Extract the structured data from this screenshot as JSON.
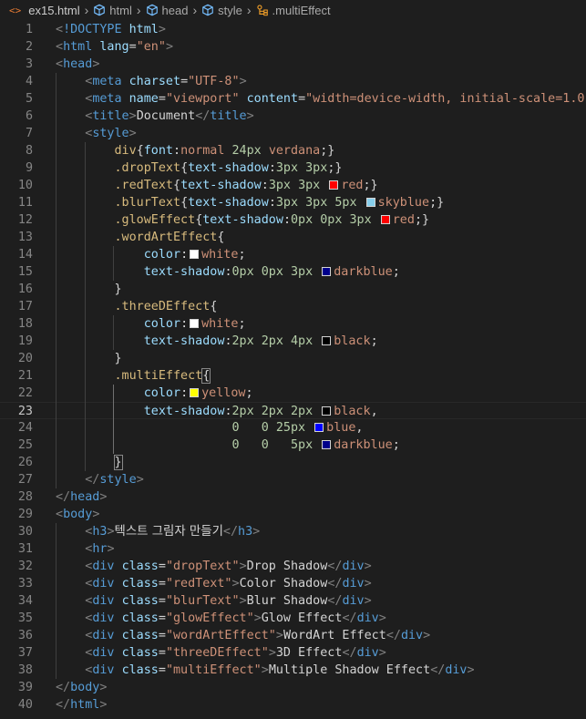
{
  "breadcrumb": {
    "file_icon": "<>",
    "file": "ex15.html",
    "items": [
      "html",
      "head",
      "style"
    ],
    "symbol": ".multiEffect"
  },
  "editor": {
    "line_numbers": [
      "1",
      "2",
      "3",
      "4",
      "5",
      "6",
      "7",
      "8",
      "9",
      "10",
      "11",
      "12",
      "13",
      "14",
      "15",
      "16",
      "17",
      "18",
      "19",
      "20",
      "21",
      "22",
      "23",
      "24",
      "25",
      "26",
      "27",
      "28",
      "29",
      "30",
      "31",
      "32",
      "33",
      "34",
      "35",
      "36",
      "37",
      "38",
      "39",
      "40"
    ],
    "active_line": 23,
    "lines": [
      [
        [
          "brk",
          "<"
        ],
        [
          "tag",
          "!DOCTYPE"
        ],
        [
          "txt",
          " "
        ],
        [
          "attr",
          "html"
        ],
        [
          "brk",
          ">"
        ]
      ],
      [
        [
          "brk",
          "<"
        ],
        [
          "tag",
          "html"
        ],
        [
          "txt",
          " "
        ],
        [
          "attr",
          "lang"
        ],
        [
          "txt",
          "="
        ],
        [
          "str",
          "\"en\""
        ],
        [
          "brk",
          ">"
        ]
      ],
      [
        [
          "brk",
          "<"
        ],
        [
          "tag",
          "head"
        ],
        [
          "brk",
          ">"
        ]
      ],
      [
        [
          "txt",
          "    "
        ],
        [
          "brk",
          "<"
        ],
        [
          "tag",
          "meta"
        ],
        [
          "txt",
          " "
        ],
        [
          "attr",
          "charset"
        ],
        [
          "txt",
          "="
        ],
        [
          "str",
          "\"UTF-8\""
        ],
        [
          "brk",
          ">"
        ]
      ],
      [
        [
          "txt",
          "    "
        ],
        [
          "brk",
          "<"
        ],
        [
          "tag",
          "meta"
        ],
        [
          "txt",
          " "
        ],
        [
          "attr",
          "name"
        ],
        [
          "txt",
          "="
        ],
        [
          "str",
          "\"viewport\""
        ],
        [
          "txt",
          " "
        ],
        [
          "attr",
          "content"
        ],
        [
          "txt",
          "="
        ],
        [
          "str",
          "\"width=device-width, initial-scale=1.0\""
        ],
        [
          "brk",
          ">"
        ]
      ],
      [
        [
          "txt",
          "    "
        ],
        [
          "brk",
          "<"
        ],
        [
          "tag",
          "title"
        ],
        [
          "brk",
          ">"
        ],
        [
          "txt",
          "Document"
        ],
        [
          "brk",
          "</"
        ],
        [
          "tag",
          "title"
        ],
        [
          "brk",
          ">"
        ]
      ],
      [
        [
          "txt",
          "    "
        ],
        [
          "brk",
          "<"
        ],
        [
          "tag",
          "style"
        ],
        [
          "brk",
          ">"
        ]
      ],
      [
        [
          "txt",
          "        "
        ],
        [
          "sel",
          "div"
        ],
        [
          "txt",
          "{"
        ],
        [
          "prop",
          "font"
        ],
        [
          "txt",
          ":"
        ],
        [
          "val",
          "normal"
        ],
        [
          "txt",
          " "
        ],
        [
          "num",
          "24px"
        ],
        [
          "txt",
          " "
        ],
        [
          "val",
          "verdana"
        ],
        [
          "txt",
          ";}"
        ]
      ],
      [
        [
          "txt",
          "        "
        ],
        [
          "sel",
          ".dropText"
        ],
        [
          "txt",
          "{"
        ],
        [
          "prop",
          "text-shadow"
        ],
        [
          "txt",
          ":"
        ],
        [
          "num",
          "3px"
        ],
        [
          "txt",
          " "
        ],
        [
          "num",
          "3px"
        ],
        [
          "txt",
          ";}"
        ]
      ],
      [
        [
          "txt",
          "        "
        ],
        [
          "sel",
          ".redText"
        ],
        [
          "txt",
          "{"
        ],
        [
          "prop",
          "text-shadow"
        ],
        [
          "txt",
          ":"
        ],
        [
          "num",
          "3px"
        ],
        [
          "txt",
          " "
        ],
        [
          "num",
          "3px"
        ],
        [
          "txt",
          " "
        ],
        [
          "sw",
          "#ff0000"
        ],
        [
          "val",
          "red"
        ],
        [
          "txt",
          ";}"
        ]
      ],
      [
        [
          "txt",
          "        "
        ],
        [
          "sel",
          ".blurText"
        ],
        [
          "txt",
          "{"
        ],
        [
          "prop",
          "text-shadow"
        ],
        [
          "txt",
          ":"
        ],
        [
          "num",
          "3px"
        ],
        [
          "txt",
          " "
        ],
        [
          "num",
          "3px"
        ],
        [
          "txt",
          " "
        ],
        [
          "num",
          "5px"
        ],
        [
          "txt",
          " "
        ],
        [
          "sw",
          "#87ceeb"
        ],
        [
          "val",
          "skyblue"
        ],
        [
          "txt",
          ";}"
        ]
      ],
      [
        [
          "txt",
          "        "
        ],
        [
          "sel",
          ".glowEffect"
        ],
        [
          "txt",
          "{"
        ],
        [
          "prop",
          "text-shadow"
        ],
        [
          "txt",
          ":"
        ],
        [
          "num",
          "0px"
        ],
        [
          "txt",
          " "
        ],
        [
          "num",
          "0px"
        ],
        [
          "txt",
          " "
        ],
        [
          "num",
          "3px"
        ],
        [
          "txt",
          " "
        ],
        [
          "sw",
          "#ff0000"
        ],
        [
          "val",
          "red"
        ],
        [
          "txt",
          ";}"
        ]
      ],
      [
        [
          "txt",
          "        "
        ],
        [
          "sel",
          ".wordArtEffect"
        ],
        [
          "txt",
          "{"
        ]
      ],
      [
        [
          "txt",
          "            "
        ],
        [
          "prop",
          "color"
        ],
        [
          "txt",
          ":"
        ],
        [
          "sw",
          "#ffffff"
        ],
        [
          "val",
          "white"
        ],
        [
          "txt",
          ";"
        ]
      ],
      [
        [
          "txt",
          "            "
        ],
        [
          "prop",
          "text-shadow"
        ],
        [
          "txt",
          ":"
        ],
        [
          "num",
          "0px"
        ],
        [
          "txt",
          " "
        ],
        [
          "num",
          "0px"
        ],
        [
          "txt",
          " "
        ],
        [
          "num",
          "3px"
        ],
        [
          "txt",
          " "
        ],
        [
          "sw",
          "#00008b"
        ],
        [
          "val",
          "darkblue"
        ],
        [
          "txt",
          ";"
        ]
      ],
      [
        [
          "txt",
          "        }"
        ]
      ],
      [
        [
          "txt",
          "        "
        ],
        [
          "sel",
          ".threeDEffect"
        ],
        [
          "txt",
          "{"
        ]
      ],
      [
        [
          "txt",
          "            "
        ],
        [
          "prop",
          "color"
        ],
        [
          "txt",
          ":"
        ],
        [
          "sw",
          "#ffffff"
        ],
        [
          "val",
          "white"
        ],
        [
          "txt",
          ";"
        ]
      ],
      [
        [
          "txt",
          "            "
        ],
        [
          "prop",
          "text-shadow"
        ],
        [
          "txt",
          ":"
        ],
        [
          "num",
          "2px"
        ],
        [
          "txt",
          " "
        ],
        [
          "num",
          "2px"
        ],
        [
          "txt",
          " "
        ],
        [
          "num",
          "4px"
        ],
        [
          "txt",
          " "
        ],
        [
          "sw",
          "#000000"
        ],
        [
          "val",
          "black"
        ],
        [
          "txt",
          ";"
        ]
      ],
      [
        [
          "txt",
          "        }"
        ]
      ],
      [
        [
          "txt",
          "        "
        ],
        [
          "sel",
          ".multiEffect"
        ],
        [
          "bm",
          "{"
        ]
      ],
      [
        [
          "txt",
          "            "
        ],
        [
          "prop",
          "color"
        ],
        [
          "txt",
          ":"
        ],
        [
          "sw",
          "#ffff00"
        ],
        [
          "val",
          "yellow"
        ],
        [
          "txt",
          ";"
        ]
      ],
      [
        [
          "txt",
          "            "
        ],
        [
          "prop",
          "text-shadow"
        ],
        [
          "txt",
          ":"
        ],
        [
          "num",
          "2px"
        ],
        [
          "txt",
          " "
        ],
        [
          "num",
          "2px"
        ],
        [
          "txt",
          " "
        ],
        [
          "num",
          "2px"
        ],
        [
          "txt",
          " "
        ],
        [
          "sw",
          "#000000"
        ],
        [
          "val",
          "black"
        ],
        [
          "txt",
          ","
        ]
      ],
      [
        [
          "txt",
          "                        "
        ],
        [
          "num",
          "0"
        ],
        [
          "txt",
          "   "
        ],
        [
          "num",
          "0"
        ],
        [
          "txt",
          " "
        ],
        [
          "num",
          "25px"
        ],
        [
          "txt",
          " "
        ],
        [
          "sw",
          "#0000ff"
        ],
        [
          "val",
          "blue"
        ],
        [
          "txt",
          ","
        ]
      ],
      [
        [
          "txt",
          "                        "
        ],
        [
          "num",
          "0"
        ],
        [
          "txt",
          "   "
        ],
        [
          "num",
          "0"
        ],
        [
          "txt",
          "   "
        ],
        [
          "num",
          "5px"
        ],
        [
          "txt",
          " "
        ],
        [
          "sw",
          "#00008b"
        ],
        [
          "val",
          "darkblue"
        ],
        [
          "txt",
          ";"
        ]
      ],
      [
        [
          "txt",
          "        "
        ],
        [
          "bm",
          "}"
        ]
      ],
      [
        [
          "txt",
          "    "
        ],
        [
          "brk",
          "</"
        ],
        [
          "tag",
          "style"
        ],
        [
          "brk",
          ">"
        ]
      ],
      [
        [
          "brk",
          "</"
        ],
        [
          "tag",
          "head"
        ],
        [
          "brk",
          ">"
        ]
      ],
      [
        [
          "brk",
          "<"
        ],
        [
          "tag",
          "body"
        ],
        [
          "brk",
          ">"
        ]
      ],
      [
        [
          "txt",
          "    "
        ],
        [
          "brk",
          "<"
        ],
        [
          "tag",
          "h3"
        ],
        [
          "brk",
          ">"
        ],
        [
          "kr",
          "텍스트 그림자 만들기"
        ],
        [
          "brk",
          "</"
        ],
        [
          "tag",
          "h3"
        ],
        [
          "brk",
          ">"
        ]
      ],
      [
        [
          "txt",
          "    "
        ],
        [
          "brk",
          "<"
        ],
        [
          "tag",
          "hr"
        ],
        [
          "brk",
          ">"
        ]
      ],
      [
        [
          "txt",
          "    "
        ],
        [
          "brk",
          "<"
        ],
        [
          "tag",
          "div"
        ],
        [
          "txt",
          " "
        ],
        [
          "attr",
          "class"
        ],
        [
          "txt",
          "="
        ],
        [
          "str",
          "\"dropText\""
        ],
        [
          "brk",
          ">"
        ],
        [
          "txt",
          "Drop Shadow"
        ],
        [
          "brk",
          "</"
        ],
        [
          "tag",
          "div"
        ],
        [
          "brk",
          ">"
        ]
      ],
      [
        [
          "txt",
          "    "
        ],
        [
          "brk",
          "<"
        ],
        [
          "tag",
          "div"
        ],
        [
          "txt",
          " "
        ],
        [
          "attr",
          "class"
        ],
        [
          "txt",
          "="
        ],
        [
          "str",
          "\"redText\""
        ],
        [
          "brk",
          ">"
        ],
        [
          "txt",
          "Color Shadow"
        ],
        [
          "brk",
          "</"
        ],
        [
          "tag",
          "div"
        ],
        [
          "brk",
          ">"
        ]
      ],
      [
        [
          "txt",
          "    "
        ],
        [
          "brk",
          "<"
        ],
        [
          "tag",
          "div"
        ],
        [
          "txt",
          " "
        ],
        [
          "attr",
          "class"
        ],
        [
          "txt",
          "="
        ],
        [
          "str",
          "\"blurText\""
        ],
        [
          "brk",
          ">"
        ],
        [
          "txt",
          "Blur Shadow"
        ],
        [
          "brk",
          "</"
        ],
        [
          "tag",
          "div"
        ],
        [
          "brk",
          ">"
        ]
      ],
      [
        [
          "txt",
          "    "
        ],
        [
          "brk",
          "<"
        ],
        [
          "tag",
          "div"
        ],
        [
          "txt",
          " "
        ],
        [
          "attr",
          "class"
        ],
        [
          "txt",
          "="
        ],
        [
          "str",
          "\"glowEffect\""
        ],
        [
          "brk",
          ">"
        ],
        [
          "txt",
          "Glow Effect"
        ],
        [
          "brk",
          "</"
        ],
        [
          "tag",
          "div"
        ],
        [
          "brk",
          ">"
        ]
      ],
      [
        [
          "txt",
          "    "
        ],
        [
          "brk",
          "<"
        ],
        [
          "tag",
          "div"
        ],
        [
          "txt",
          " "
        ],
        [
          "attr",
          "class"
        ],
        [
          "txt",
          "="
        ],
        [
          "str",
          "\"wordArtEffect\""
        ],
        [
          "brk",
          ">"
        ],
        [
          "txt",
          "WordArt Effect"
        ],
        [
          "brk",
          "</"
        ],
        [
          "tag",
          "div"
        ],
        [
          "brk",
          ">"
        ]
      ],
      [
        [
          "txt",
          "    "
        ],
        [
          "brk",
          "<"
        ],
        [
          "tag",
          "div"
        ],
        [
          "txt",
          " "
        ],
        [
          "attr",
          "class"
        ],
        [
          "txt",
          "="
        ],
        [
          "str",
          "\"threeDEffect\""
        ],
        [
          "brk",
          ">"
        ],
        [
          "txt",
          "3D Effect"
        ],
        [
          "brk",
          "</"
        ],
        [
          "tag",
          "div"
        ],
        [
          "brk",
          ">"
        ]
      ],
      [
        [
          "txt",
          "    "
        ],
        [
          "brk",
          "<"
        ],
        [
          "tag",
          "div"
        ],
        [
          "txt",
          " "
        ],
        [
          "attr",
          "class"
        ],
        [
          "txt",
          "="
        ],
        [
          "str",
          "\"multiEffect\""
        ],
        [
          "brk",
          ">"
        ],
        [
          "txt",
          "Multiple Shadow Effect"
        ],
        [
          "brk",
          "</"
        ],
        [
          "tag",
          "div"
        ],
        [
          "brk",
          ">"
        ]
      ],
      [
        [
          "brk",
          "</"
        ],
        [
          "tag",
          "body"
        ],
        [
          "brk",
          ">"
        ]
      ],
      [
        [
          "brk",
          "</"
        ],
        [
          "tag",
          "html"
        ],
        [
          "brk",
          ">"
        ]
      ]
    ]
  }
}
